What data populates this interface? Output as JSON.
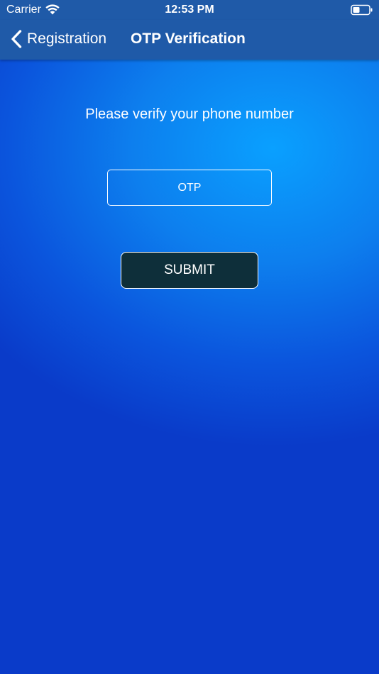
{
  "status_bar": {
    "carrier": "Carrier",
    "time": "12:53 PM",
    "wifi_icon": "wifi-icon",
    "battery_icon": "battery-icon"
  },
  "nav": {
    "back_label": "Registration",
    "back_icon": "chevron-left-icon",
    "title": "OTP Verification",
    "bar_color": "#1f5aa8"
  },
  "content": {
    "prompt": "Please verify your phone number",
    "otp_placeholder": "OTP",
    "otp_value": "",
    "submit_label": "SUBMIT",
    "submit_color": "#0e2f3a"
  }
}
